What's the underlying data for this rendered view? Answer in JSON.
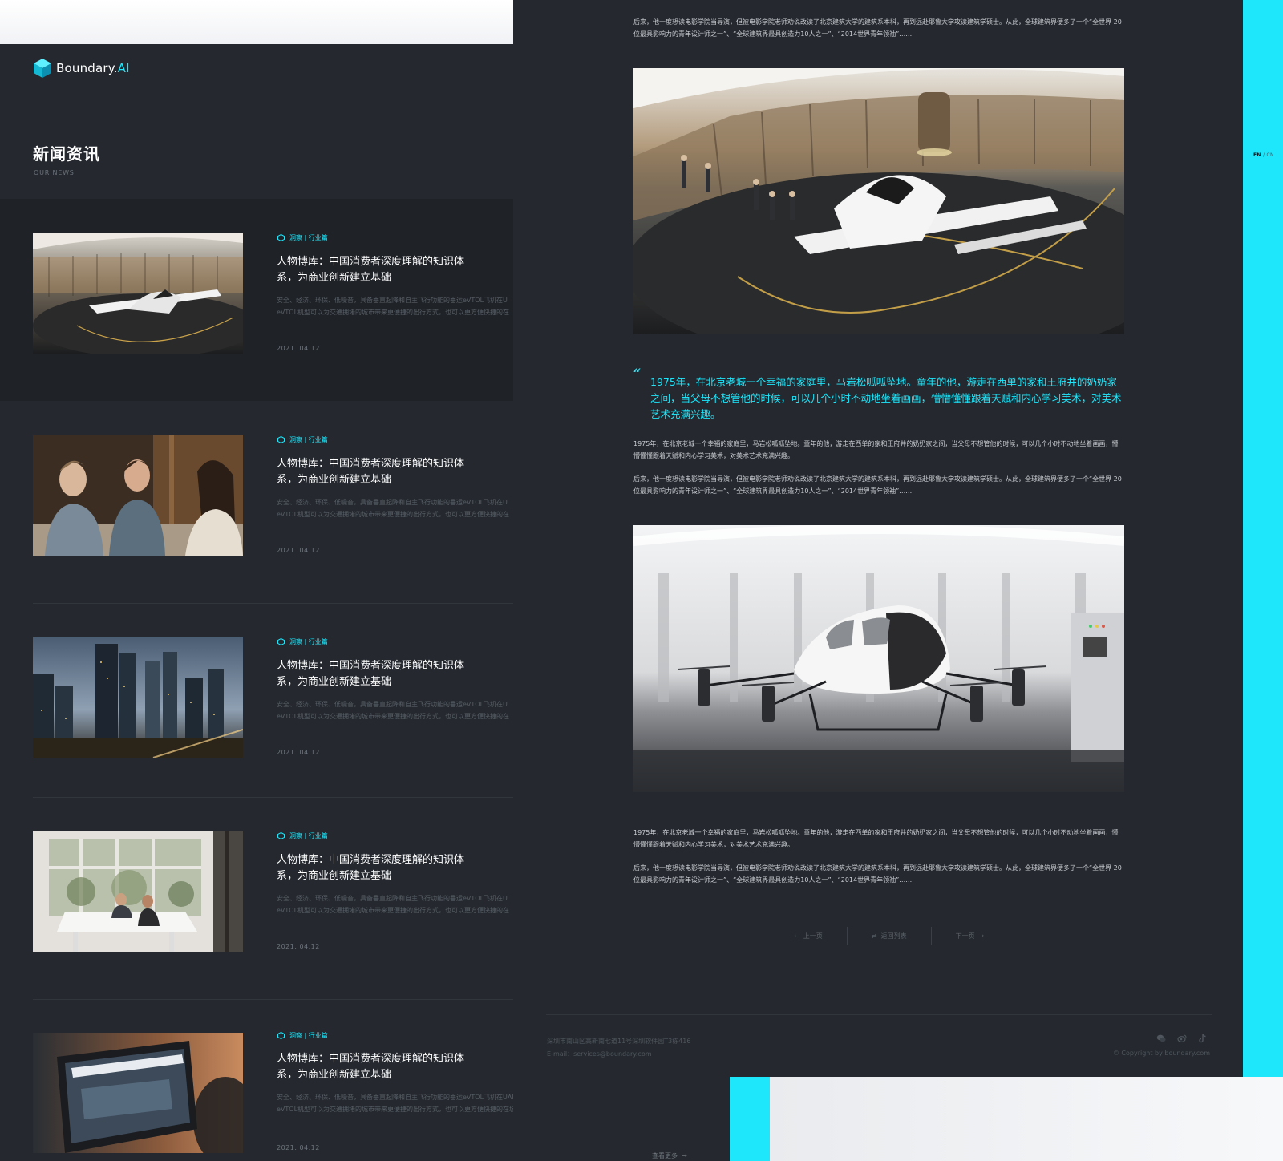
{
  "brand": {
    "name": "Boundary.",
    "name_accent": "AI"
  },
  "lang": {
    "active": "EN",
    "sep": " / ",
    "inactive": "CN"
  },
  "page": {
    "title": "新闻资讯",
    "subtitle": "OUR NEWS"
  },
  "news": [
    {
      "tag": "洞察 | 行业篇",
      "title": "人物博库：中国消费者深度理解的知识体系，为商业创新建立基础",
      "summary1": "安全、经济、环保、低噪音，具备垂直起降和自主飞行功能的垂运eVTOL飞机在U",
      "summary2": "eVTOL机型可以为交通拥堵的城市带来更便捷的出行方式，也可以更方便快捷的在",
      "date": "2021. 04.12",
      "image": "aircraft-terminal-photo"
    },
    {
      "tag": "洞察 | 行业篇",
      "title": "人物博库：中国消费者深度理解的知识体系，为商业创新建立基础",
      "summary1": "安全、经济、环保、低噪音，具备垂直起降和自主飞行功能的垂运eVTOL飞机在U",
      "summary2": "eVTOL机型可以为交通拥堵的城市带来更便捷的出行方式，也可以更方便快捷的在",
      "date": "2021. 04.12",
      "image": "team-meeting-photo"
    },
    {
      "tag": "洞察 | 行业篇",
      "title": "人物博库：中国消费者深度理解的知识体系，为商业创新建立基础",
      "summary1": "安全、经济、环保、低噪音，具备垂直起降和自主飞行功能的垂运eVTOL飞机在U",
      "summary2": "eVTOL机型可以为交通拥堵的城市带来更便捷的出行方式，也可以更方便快捷的在",
      "date": "2021. 04.12",
      "image": "city-skyline-photo"
    },
    {
      "tag": "洞察 | 行业篇",
      "title": "人物博库：中国消费者深度理解的知识体系，为商业创新建立基础",
      "summary1": "安全、经济、环保、低噪音，具备垂直起降和自主飞行功能的垂运eVTOL飞机在U",
      "summary2": "eVTOL机型可以为交通拥堵的城市带来更便捷的出行方式，也可以更方便快捷的在",
      "date": "2021. 04.12",
      "image": "office-desk-photo"
    },
    {
      "tag": "洞察 | 行业篇",
      "title": "人物博库：中国消费者深度理解的知识体系，为商业创新建立基础",
      "summary1": "安全、经济、环保、低噪音，具备垂直起降和自主飞行功能的垂运eVTOL飞机在UAM领域具备巨大的市场前景。",
      "summary2": "eVTOL机型可以为交通拥堵的城市带来更便捷的出行方式，也可以更方便快捷的在城市与城市之间穿梭。",
      "date": "2021. 04.12",
      "image": "laptop-photo"
    }
  ],
  "more_link": "查看更多",
  "article": {
    "top_para": "后来，他一度想读电影学院当导演，但被电影学院老师劝说改读了北京建筑大学的建筑系本科，再到远赴耶鲁大学攻读建筑学硕士。从此，全球建筑界便多了一个“全世界 20位最具影响力的青年设计师之一”、“全球建筑界最具创造力10人之一”、“2014世界青年领袖”……",
    "quote": "1975年，在北京老城一个幸福的家庭里，马岩松呱呱坠地。童年的他，游走在西单的家和王府井的奶奶家之间，当父母不想管他的时候，可以几个小时不动地坐着画画，懵懵懂懂跟着天赋和内心学习美术，对美术艺术充满兴趣。",
    "p1": "1975年，在北京老城一个幸福的家庭里，马岩松呱呱坠地。童年的他，游走在西单的家和王府井的奶奶家之间，当父母不想管他的时候，可以几个小时不动地坐着画画，懵懵懂懂跟着天赋和内心学习美术，对美术艺术充满兴趣。",
    "p2": "后来，他一度想读电影学院当导演，但被电影学院老师劝说改读了北京建筑大学的建筑系本科，再到远赴耶鲁大学攻读建筑学硕士。从此，全球建筑界便多了一个“全世界 20位最具影响力的青年设计师之一”、“全球建筑界最具创造力10人之一”、“2014世界青年领袖”……",
    "p3": "1975年，在北京老城一个幸福的家庭里，马岩松呱呱坠地。童年的他，游走在西单的家和王府井的奶奶家之间，当父母不想管他的时候，可以几个小时不动地坐着画画，懵懵懂懂跟着天赋和内心学习美术，对美术艺术充满兴趣。",
    "p4": "后来，他一度想读电影学院当导演，但被电影学院老师劝说改读了北京建筑大学的建筑系本科，再到远赴耶鲁大学攻读建筑学硕士。从此，全球建筑界便多了一个“全世界 20位最具影响力的青年设计师之一”、“全球建筑界最具创造力10人之一”、“2014世界青年领袖”……",
    "image1": "evtol-terminal-photo",
    "image2": "ehang-216-drone-photo"
  },
  "pager": {
    "prev": "上一页",
    "list": "返回列表",
    "next": "下一页"
  },
  "footer": {
    "address": "深圳市南山区高新南七道11号深圳软件园T3栋416",
    "email": "E-mail：services@boundary.com",
    "copyright": "© Copyright by boundary.com",
    "icons": [
      "wechat-icon",
      "weibo-icon",
      "tiktok-icon"
    ]
  },
  "colors": {
    "accent": "#1ee6fb",
    "panel": "#25292f",
    "active_row": "#1f2227"
  }
}
